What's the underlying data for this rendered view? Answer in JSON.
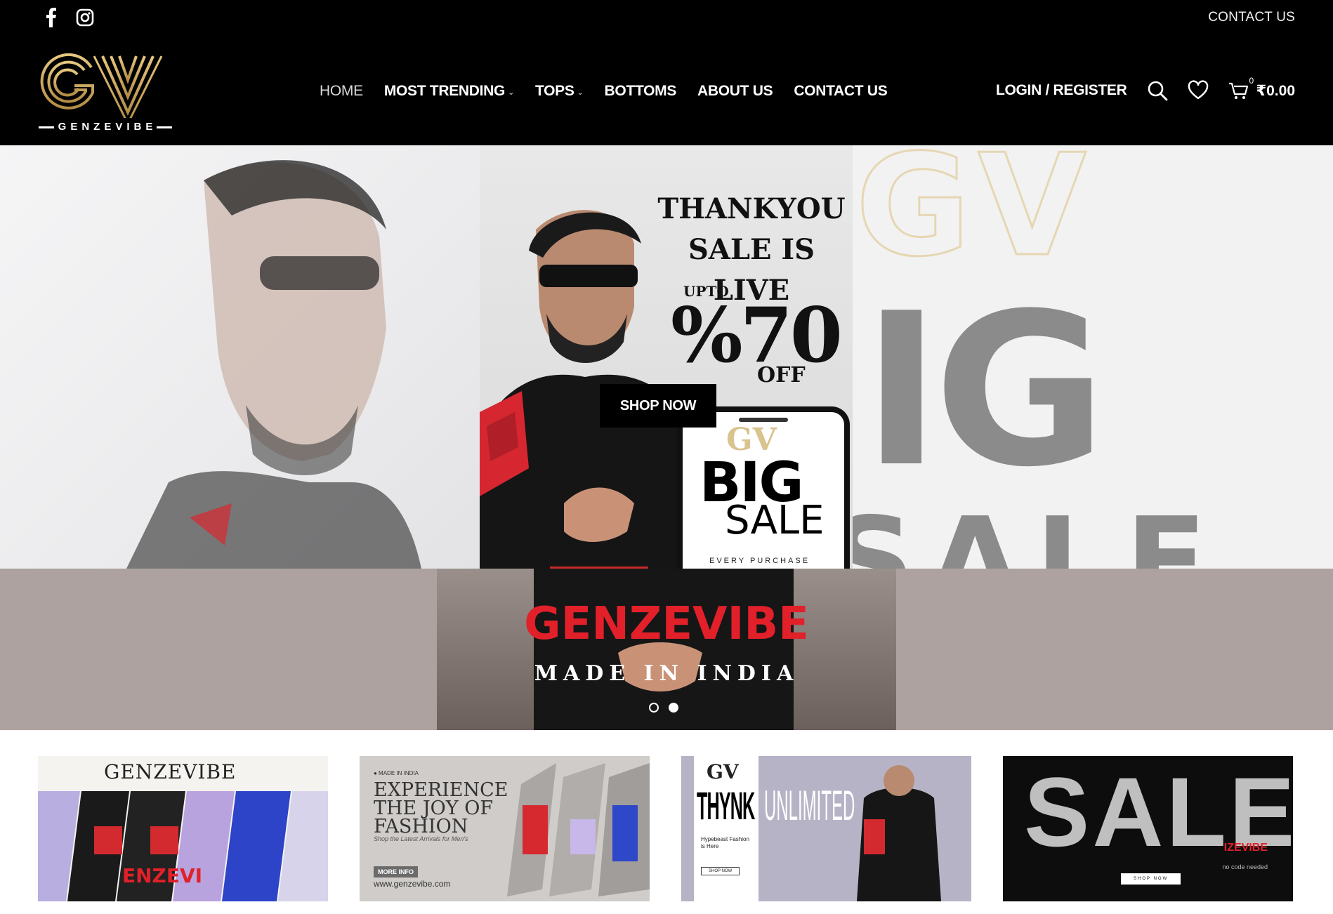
{
  "topbar": {
    "social": [
      "facebook-icon",
      "instagram-icon"
    ],
    "contact_label": "CONTACT US"
  },
  "logo": {
    "monogram": "GV",
    "brand": "GENZEVIBE"
  },
  "nav": {
    "items": [
      {
        "label": "HOME",
        "active": true,
        "dropdown": false
      },
      {
        "label": "MOST TRENDING",
        "active": false,
        "dropdown": true
      },
      {
        "label": "TOPS",
        "active": false,
        "dropdown": true
      },
      {
        "label": "BOTTOMS",
        "active": false,
        "dropdown": false
      },
      {
        "label": "ABOUT US",
        "active": false,
        "dropdown": false
      },
      {
        "label": "CONTACT US",
        "active": false,
        "dropdown": false
      }
    ],
    "login_label": "LOGIN / REGISTER",
    "cart_count": "0",
    "cart_total": "₹0.00"
  },
  "hero": {
    "line1": "THANKYOU",
    "line2": "SALE IS LIVE",
    "upto": "UPTO",
    "percent": "%70",
    "off": "OFF",
    "shop_now": "SHOP NOW",
    "phone_logo": "GV",
    "phone_big": "BIG",
    "phone_sale": "SALE",
    "phone_caption": "EVERY PURCHASE",
    "bg_logo": "GV",
    "bg_big": "IG",
    "bg_sale": "SALE",
    "brand": "GENZEVIBE",
    "made_in": "MADE IN INDIA",
    "slides": 2,
    "active_slide": 2
  },
  "banners": {
    "b1": {
      "title": "GENZEVIBE"
    },
    "b2": {
      "tag": "● MADE IN INDIA",
      "title": "EXPERIENCE THE JOY OF FASHION",
      "subtitle": "Shop the Latest Arrivals for Men's",
      "more": "MORE INFO",
      "url": "www.genzevibe.com"
    },
    "b3": {
      "logo": "GV",
      "thynk": "THYNK",
      "unlimited": "UNLIMITED",
      "hype": "Hypebeast Fashion is Here",
      "shop": "SHOP NOW"
    },
    "b4": {
      "sale": "SALE",
      "brand": "IZEVIBE",
      "code": "no code needed",
      "shop": "SHOP NOW"
    }
  },
  "colors": {
    "gold": "#c9a45c",
    "red": "#e2202a",
    "black": "#000000"
  }
}
